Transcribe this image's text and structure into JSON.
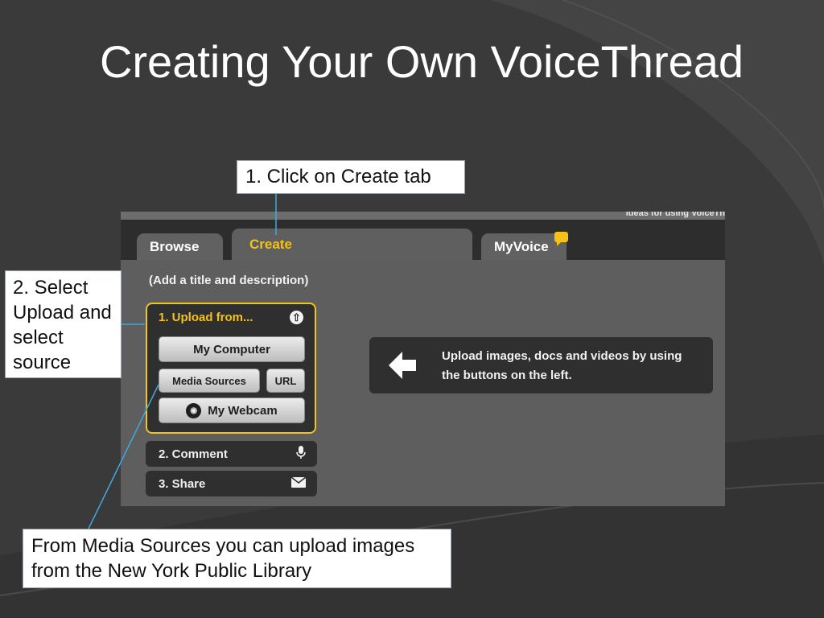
{
  "slide": {
    "title": "Creating Your Own VoiceThread"
  },
  "callouts": {
    "step1": "1. Click on Create tab",
    "step2": "2. Select Upload and select source",
    "media_sources_note": "From Media Sources you can upload images from the New York Public Library"
  },
  "app": {
    "topbar_text": "Ideas for using VoiceTh",
    "tabs": [
      {
        "label": "Browse"
      },
      {
        "label": "Create",
        "active": true
      },
      {
        "label": "MyVoice",
        "badge_icon": "message-bubble-icon"
      }
    ],
    "add_title_label": "(Add a title and description)",
    "upload_panel": {
      "heading": "1. Upload from...",
      "heading_icon": "up-arrow-circle-icon",
      "buttons": {
        "my_computer": "My Computer",
        "media_sources": "Media Sources",
        "url": "URL",
        "my_webcam": "My Webcam"
      },
      "webcam_icon": "camera-icon"
    },
    "steps": [
      {
        "label": "2. Comment",
        "icon": "microphone-icon"
      },
      {
        "label": "3. Share",
        "icon": "envelope-icon"
      }
    ],
    "info": {
      "icon": "left-arrow-icon",
      "text": "Upload images, docs and videos by using the buttons on the left."
    }
  },
  "colors": {
    "background": "#3a3a3a",
    "accent_yellow": "#f5c21a",
    "callout_line": "#3fa9e0"
  }
}
